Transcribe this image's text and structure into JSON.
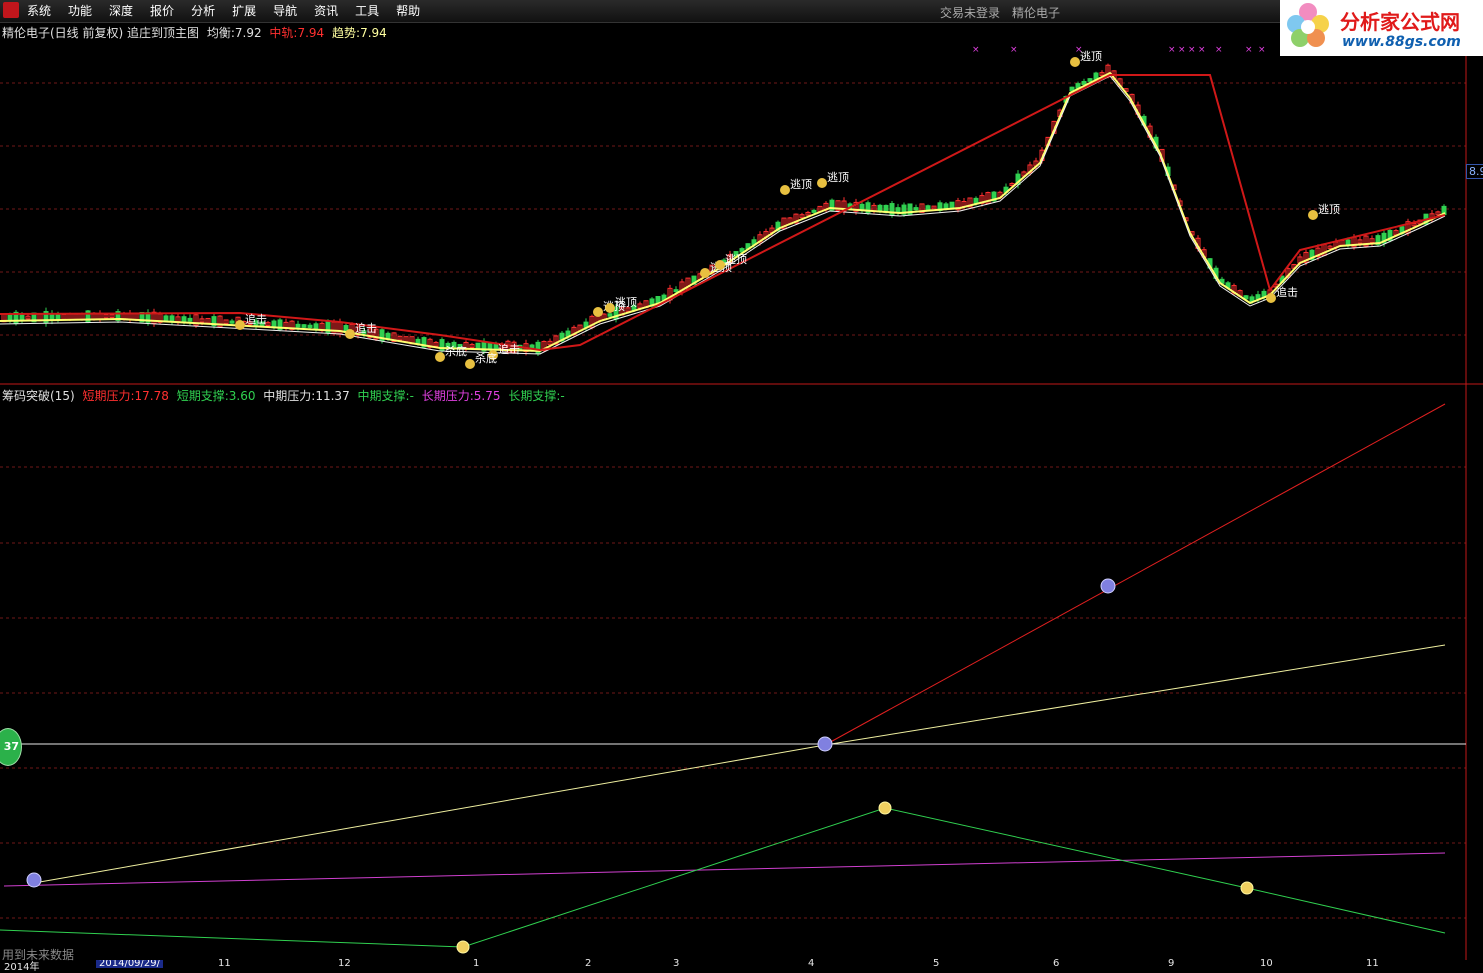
{
  "menu": [
    "系统",
    "功能",
    "深度",
    "报价",
    "分析",
    "扩展",
    "导航",
    "资讯",
    "工具",
    "帮助"
  ],
  "status": {
    "login": "交易未登录",
    "company": "精伦电子"
  },
  "watermark": {
    "title": "分析家公式网",
    "url": "www.88gs.com"
  },
  "main_panel": {
    "title": "精伦电子(日线 前复权) 追庄到顶主图",
    "balance_label": "均衡:",
    "balance_value": "7.92",
    "mid_label": "中轨:",
    "mid_value": "7.94",
    "trend_label": "趋势:",
    "trend_value": "7.94",
    "price_tag": "8.9",
    "annotations": [
      "逃顶",
      "逃顶",
      "逃顶",
      "逃顶",
      "逃顶",
      "逃顶",
      "逃顶",
      "追击",
      "追击",
      "追击",
      "追击",
      "杀底",
      "杀底"
    ]
  },
  "sub_panel": {
    "title": "筹码突破(15)",
    "short_pressure_label": "短期压力:",
    "short_pressure_value": "17.78",
    "short_support_label": "短期支撑:",
    "short_support_value": "3.60",
    "mid_pressure_label": "中期压力:",
    "mid_pressure_value": "11.37",
    "mid_support_label": "中期支撑:",
    "mid_support_value": "-",
    "long_pressure_label": "长期压力:",
    "long_pressure_value": "5.75",
    "long_support_label": "长期支撑:",
    "long_support_value": "-",
    "badge": "37",
    "note": "用到未来数据"
  },
  "time_axis": {
    "first_label": "2014年",
    "selected_date": "2014/09/29/",
    "ticks": [
      "11",
      "12",
      "1",
      "2",
      "3",
      "4",
      "5",
      "6",
      "9",
      "10",
      "11"
    ]
  },
  "colors": {
    "up": "#ff3030",
    "down": "#30d050",
    "yellow": "#ffff70",
    "red_line": "#d01818",
    "magenta": "#c040c0",
    "grid": "#701818"
  }
}
